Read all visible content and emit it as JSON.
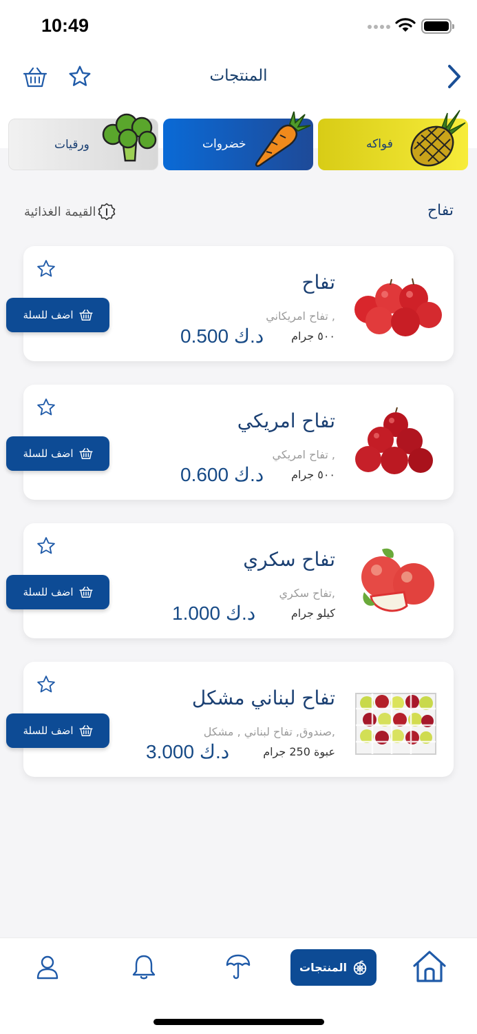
{
  "status": {
    "time": "10:49"
  },
  "header": {
    "title": "المنتجات"
  },
  "categories": [
    {
      "label": "فواكه",
      "image": "pineapple",
      "color": "#e6dc24"
    },
    {
      "label": "خضروات",
      "image": "carrot",
      "color": "#0d5fc0"
    },
    {
      "label": "ورقيات",
      "image": "broccoli",
      "color": "#e6e6e6"
    }
  ],
  "subheader": {
    "title": "تفاح",
    "nutrition_label": "القيمة الغذائية",
    "nutrition_icon": "info-icon"
  },
  "products": [
    {
      "name": "تفاح",
      "description": "تفاح امريكاني ,",
      "weight": "٥٠٠ جرام",
      "price": "0.500 د.ك",
      "image": "red-apples-pile",
      "add_label": "اضف للسلة"
    },
    {
      "name": "تفاح امريكي",
      "description": "تفاح امريكي ,",
      "weight": "٥٠٠ جرام",
      "price": "0.600 د.ك",
      "image": "red-apples-stack",
      "add_label": "اضف للسلة"
    },
    {
      "name": "تفاح سكري",
      "description": "تفاح سكري,",
      "weight": "كيلو جرام",
      "price": "1.000 د.ك",
      "image": "sugar-apples",
      "add_label": "اضف للسلة"
    },
    {
      "name": "تفاح لبناني مشكل",
      "description": "صندوق, تفاح لبناني , مشكل,",
      "weight": "عبوة 250 جرام",
      "price": "3.000 د.ك",
      "image": "apple-crate",
      "add_label": "اضف للسلة"
    }
  ],
  "bottom_nav": {
    "active_label": "المنتجات",
    "items": [
      "home-icon",
      "products-icon",
      "umbrella-icon",
      "bell-icon",
      "user-icon"
    ]
  },
  "colors": {
    "primary": "#0d4b95",
    "text": "#1a3f72",
    "background": "#f5f5f7"
  }
}
